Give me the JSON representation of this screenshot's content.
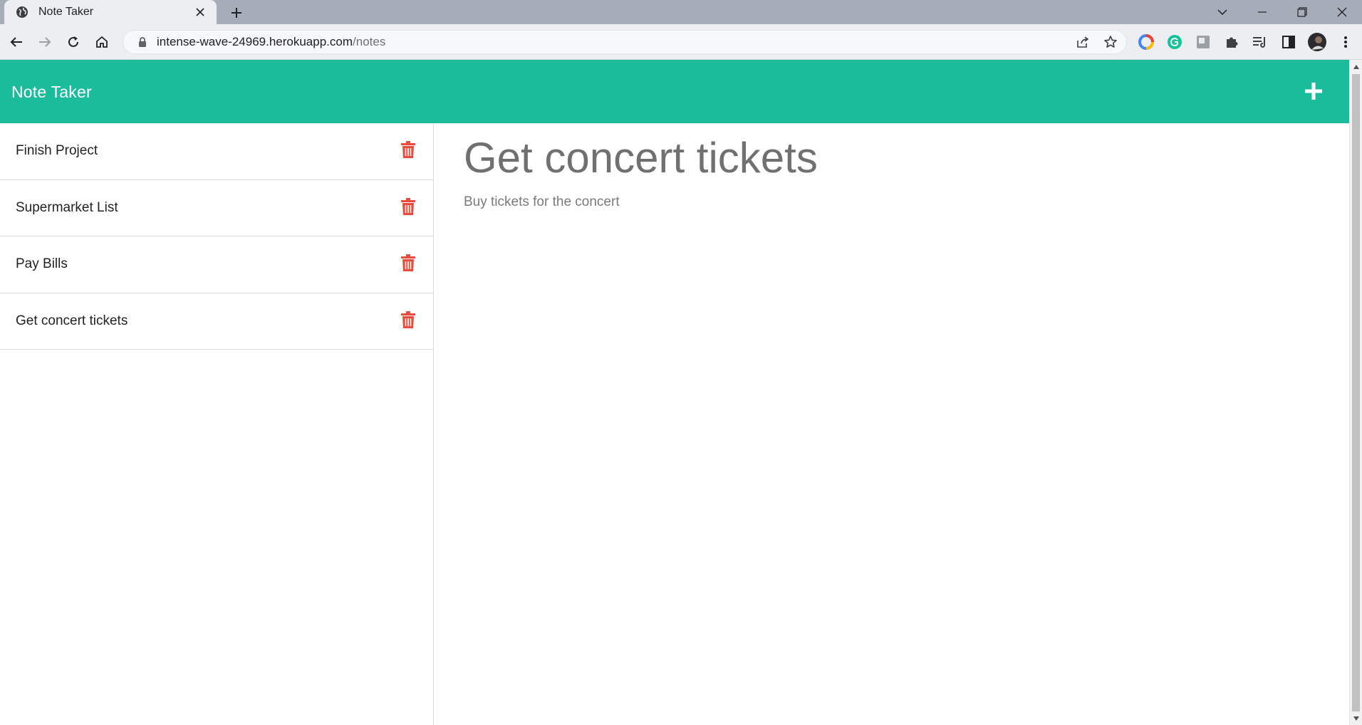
{
  "browser": {
    "tab_title": "Note Taker",
    "url_host": "intense-wave-24969.herokuapp.com",
    "url_path": "/notes"
  },
  "app": {
    "brand": "Note Taker",
    "accent_color": "#1abc9c",
    "delete_color": "#e74c3c"
  },
  "notes": [
    {
      "title": "Finish Project"
    },
    {
      "title": "Supermarket List"
    },
    {
      "title": "Pay Bills"
    },
    {
      "title": "Get concert tickets"
    }
  ],
  "active_note": {
    "title": "Get concert tickets",
    "text": "Buy tickets for the concert"
  }
}
